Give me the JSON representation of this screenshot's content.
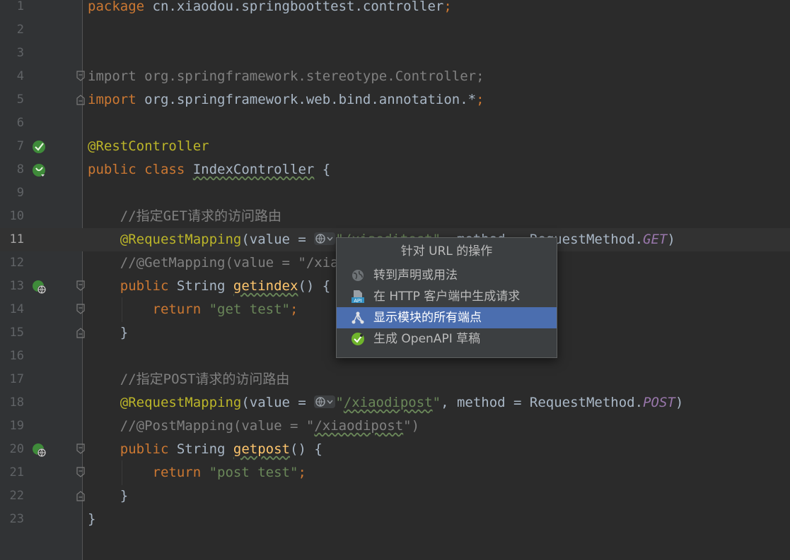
{
  "editor": {
    "line_numbers": [
      "1",
      "2",
      "3",
      "4",
      "5",
      "6",
      "7",
      "8",
      "9",
      "10",
      "11",
      "12",
      "13",
      "14",
      "15",
      "16",
      "17",
      "18",
      "19",
      "20",
      "21",
      "22",
      "23"
    ],
    "tokens": {
      "kw_package": "package",
      "package_name": " cn.xiaodou.springboottest.controller",
      "semi": ";",
      "kw_import": "import",
      "import1_path": " org.springframework.stereotype.Controller;",
      "import2_path": " org.springframework.web.bind.annotation.*",
      "ann_rest": "@RestController",
      "kw_public_class": "public class",
      "class_name": "IndexController",
      "brace_open": " {",
      "comment_get": "//指定GET请求的访问路由",
      "ann_request_mapping": "@RequestMapping",
      "value_eq": "(value = ",
      "str_get_path": "\"/xiaoditest\"",
      "method_eq": ", method = ",
      "request_method": "RequestMethod.",
      "const_get": "GET",
      "paren_close": ")",
      "comment_getmapping": "//@GetMapping(value = \"/xiaoditest\")",
      "kw_public": "public",
      "type_string": " String ",
      "fn_getindex": "getindex",
      "fn_sig_end": "() {",
      "kw_return": "return",
      "str_get_test": "\"get test\"",
      "brace_close": "}",
      "comment_post": "//指定POST请求的访问路由",
      "str_post_path_q1": "\"",
      "str_post_path": "/xiaodipost",
      "str_post_path_q2": "\"",
      "const_post": "POST",
      "comment_postmapping_a": "//@PostMapping(value = \"",
      "comment_postmapping_b": "/xiaodipost",
      "comment_postmapping_c": "\")",
      "fn_getpost": "getpost",
      "str_post_test": "\"post test\""
    }
  },
  "popup": {
    "title": "针对 URL 的操作",
    "items": [
      {
        "label": "转到声明或用法",
        "icon": "globe-icon",
        "selected": false
      },
      {
        "label": "在 HTTP 客户端中生成请求",
        "icon": "api-file-icon",
        "selected": false
      },
      {
        "label": "显示模块的所有端点",
        "icon": "endpoints-icon",
        "selected": true
      },
      {
        "label": "生成 OpenAPI 草稿",
        "icon": "openapi-icon",
        "selected": false
      }
    ]
  },
  "colors": {
    "background": "#2b2b2b",
    "gutter": "#313335",
    "keyword": "#cc7832",
    "annotation": "#bbb529",
    "string": "#6a8759",
    "comment": "#808080",
    "function": "#ffc66d",
    "constant": "#9876aa",
    "selection": "#4b6eaf"
  }
}
